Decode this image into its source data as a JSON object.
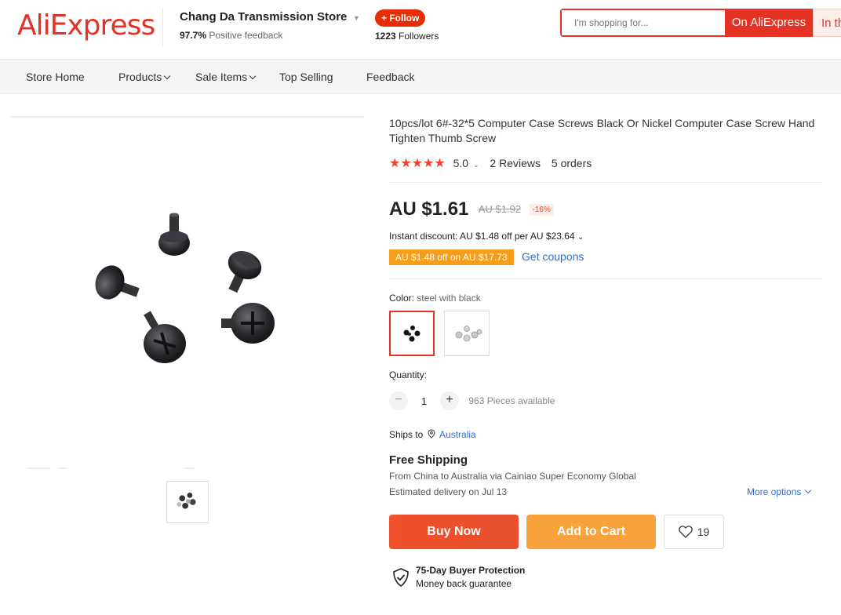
{
  "header": {
    "logo": "AliExpress",
    "store_name": "Chang Da Transmission Store",
    "feedback_percent": "97.7%",
    "feedback_label": "Positive feedback",
    "follow_label": "+ Follow",
    "followers_count": "1223",
    "followers_label": "Followers",
    "search_placeholder": "I'm shopping for...",
    "search_btn_aliexpress": "On AliExpress",
    "search_btn_store": "In th"
  },
  "nav": {
    "items": [
      {
        "label": "Store Home"
      },
      {
        "label": "Products"
      },
      {
        "label": "Sale Items"
      },
      {
        "label": "Top Selling"
      },
      {
        "label": "Feedback"
      }
    ]
  },
  "product": {
    "title": "10pcs/lot 6#-32*5 Computer Case Screws Black Or Nickel Computer Case Screw Hand Tighten Thumb Screw",
    "stars": "★★★★★",
    "rating": "5.0",
    "reviews": "2 Reviews",
    "orders": "5 orders",
    "price": "AU $1.61",
    "old_price": "AU $1.92",
    "discount": "-16%",
    "instant_discount": "Instant discount: AU $1.48 off per AU $23.64",
    "coupon": "AU $1.48 off on AU $17.73",
    "get_coupons": "Get coupons",
    "color_label": "Color:",
    "color_value": "steel with black",
    "quantity_label": "Quantity:",
    "quantity": "1",
    "minus": "−",
    "plus": "+",
    "available": "963 Pieces available",
    "ships_to_label": "Ships to",
    "ships_to_location": "Australia",
    "free_shipping": "Free Shipping",
    "shipping_detail": "From China to Australia via Cainiao Super Economy Global",
    "estimated_delivery": "Estimated delivery on Jul 13",
    "more_options": "More options",
    "buy_now": "Buy Now",
    "add_to_cart": "Add to Cart",
    "wishlist_count": "19",
    "protection_title": "75-Day Buyer Protection",
    "protection_sub": "Money back guarantee"
  },
  "colors": {
    "brand_red": "#e43225",
    "buy_now": "#f0502b",
    "add_to_cart": "#f9a23b",
    "coupon_orange": "#f89d1b",
    "link_blue": "#2e6fd8",
    "star_red": "#f5402c"
  },
  "icons": [
    "chevron-down-icon",
    "location-pin-icon",
    "heart-icon",
    "shield-check-icon"
  ]
}
